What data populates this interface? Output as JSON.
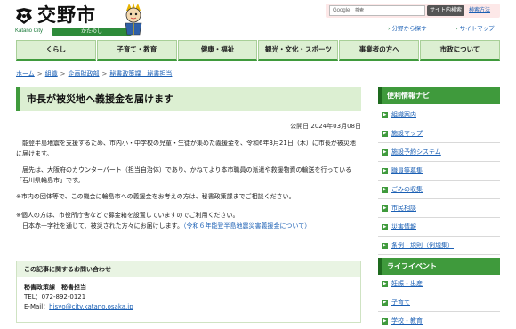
{
  "header": {
    "city_name": "交野市",
    "city_en": "Katano City",
    "city_kana": "かたのし",
    "search": {
      "provider": "Google",
      "placeholder": "検索",
      "button_label": "サイト内検索",
      "help_label": "検索方法"
    },
    "sublinks": [
      {
        "label": "分野から探す"
      },
      {
        "label": "サイトマップ"
      }
    ]
  },
  "gnav": [
    {
      "label": "くらし"
    },
    {
      "label": "子育て・教育"
    },
    {
      "label": "健康・福祉"
    },
    {
      "label": "観光・文化・スポーツ"
    },
    {
      "label": "事業者の方へ"
    },
    {
      "label": "市政について"
    }
  ],
  "breadcrumb": [
    {
      "label": "ホーム"
    },
    {
      "label": "組織"
    },
    {
      "label": "企画財政部"
    },
    {
      "label": "秘書政策課　秘書担当"
    }
  ],
  "breadcrumb_sep": ">",
  "main": {
    "title": "市長が被災地へ義援金を届けます",
    "published": "公開日 2024年03月08日",
    "paragraphs": {
      "p1": "　能登半島地震を支援するため、市内小・中学校の児童・生徒が集めた義援金を、令和6年3月21日（木）に市長が被災地に届けます。",
      "p2": "　届先は、大阪府のカウンターパート（担当自治体）であり、かねてより本市職員の派遣や救援物資の輸送を行っている「石川県輪島市」です。",
      "p3": "※市内の団体等で、この機会に輪島市への義援金をお考えの方は、秘書政策課までご相談ください。",
      "p4a": "※個人の方は、市役所庁舎などで募金箱を設置していますのでご利用ください。",
      "p4b": "　日本赤十字社を通じて、被災された方々にお届けします。",
      "p4_link": "（令和６年能登半島地震災害義援金について）"
    },
    "contact": {
      "heading": "この記事に関するお問い合わせ",
      "department": "秘書政策課　秘書担当",
      "tel": "TEL：072-892-0121",
      "email_label": "E-Mail：",
      "email": "hisyo@city.katano.osaka.jp"
    }
  },
  "sidebar": {
    "nav_title": "便利情報ナビ",
    "nav_items": [
      {
        "label": "組織案内"
      },
      {
        "label": "施設マップ"
      },
      {
        "label": "施設予約システム"
      },
      {
        "label": "職員等募集"
      },
      {
        "label": "ごみの収集"
      },
      {
        "label": "市民相談"
      },
      {
        "label": "災害情報"
      },
      {
        "label": "条例・規則（例規集）"
      }
    ],
    "life_title": "ライフイベント",
    "life_items": [
      {
        "label": "妊娠・出産"
      },
      {
        "label": "子育て"
      },
      {
        "label": "学校・教育"
      }
    ]
  },
  "colors": {
    "accent_green": "#3f9a3c",
    "nav_bg": "#dcefd2",
    "link": "#1a5fb4",
    "search_bg": "#fde8e8"
  },
  "icons": [
    "city-emblem-icon",
    "mascot-icon",
    "arrow-right-icon"
  ]
}
